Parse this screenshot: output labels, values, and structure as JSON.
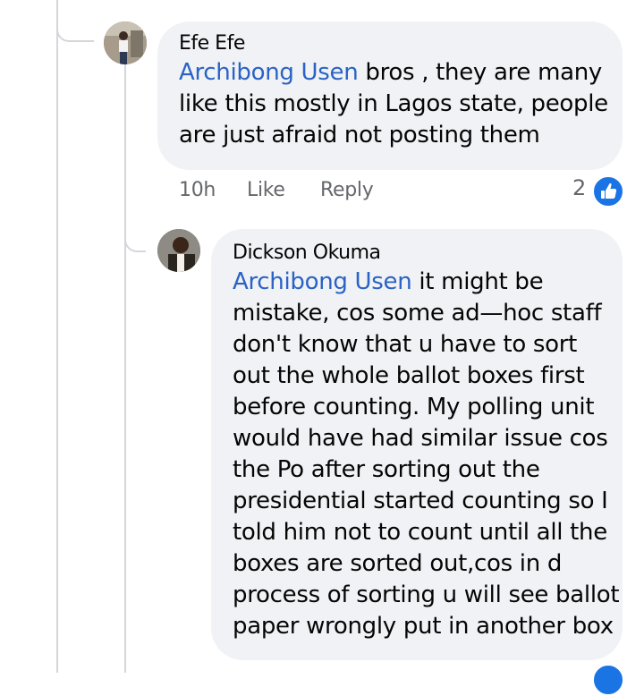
{
  "comments": [
    {
      "author": "Efe Efe",
      "mention": "Archibong Usen",
      "body_lines": [
        " bros , they are many",
        "like this mostly in Lagos state, people",
        "are just afraid not posting them"
      ],
      "time": "10h",
      "like_label": "Like",
      "reply_label": "Reply",
      "reaction_count": "2",
      "reaction_icon": "like-thumbs-up-icon"
    },
    {
      "author": "Dickson Okuma",
      "mention": "Archibong Usen",
      "body_lines": [
        " it might be",
        "mistake, cos some ad—hoc staff",
        "don't know that u have to sort",
        "out the whole ballot boxes first",
        "before counting. My polling unit",
        "would have had similar issue cos",
        "the Po after sorting out the",
        "presidential started counting so I",
        "told him not to count until all the",
        "boxes are sorted out,cos in d",
        "process of sorting u will see ballot",
        "paper wrongly put in another box"
      ]
    }
  ],
  "colors": {
    "mention": "#2a63c5",
    "bubble": "#f0f2f5",
    "meta": "#65676b",
    "like_blue": "#1b74e4"
  }
}
